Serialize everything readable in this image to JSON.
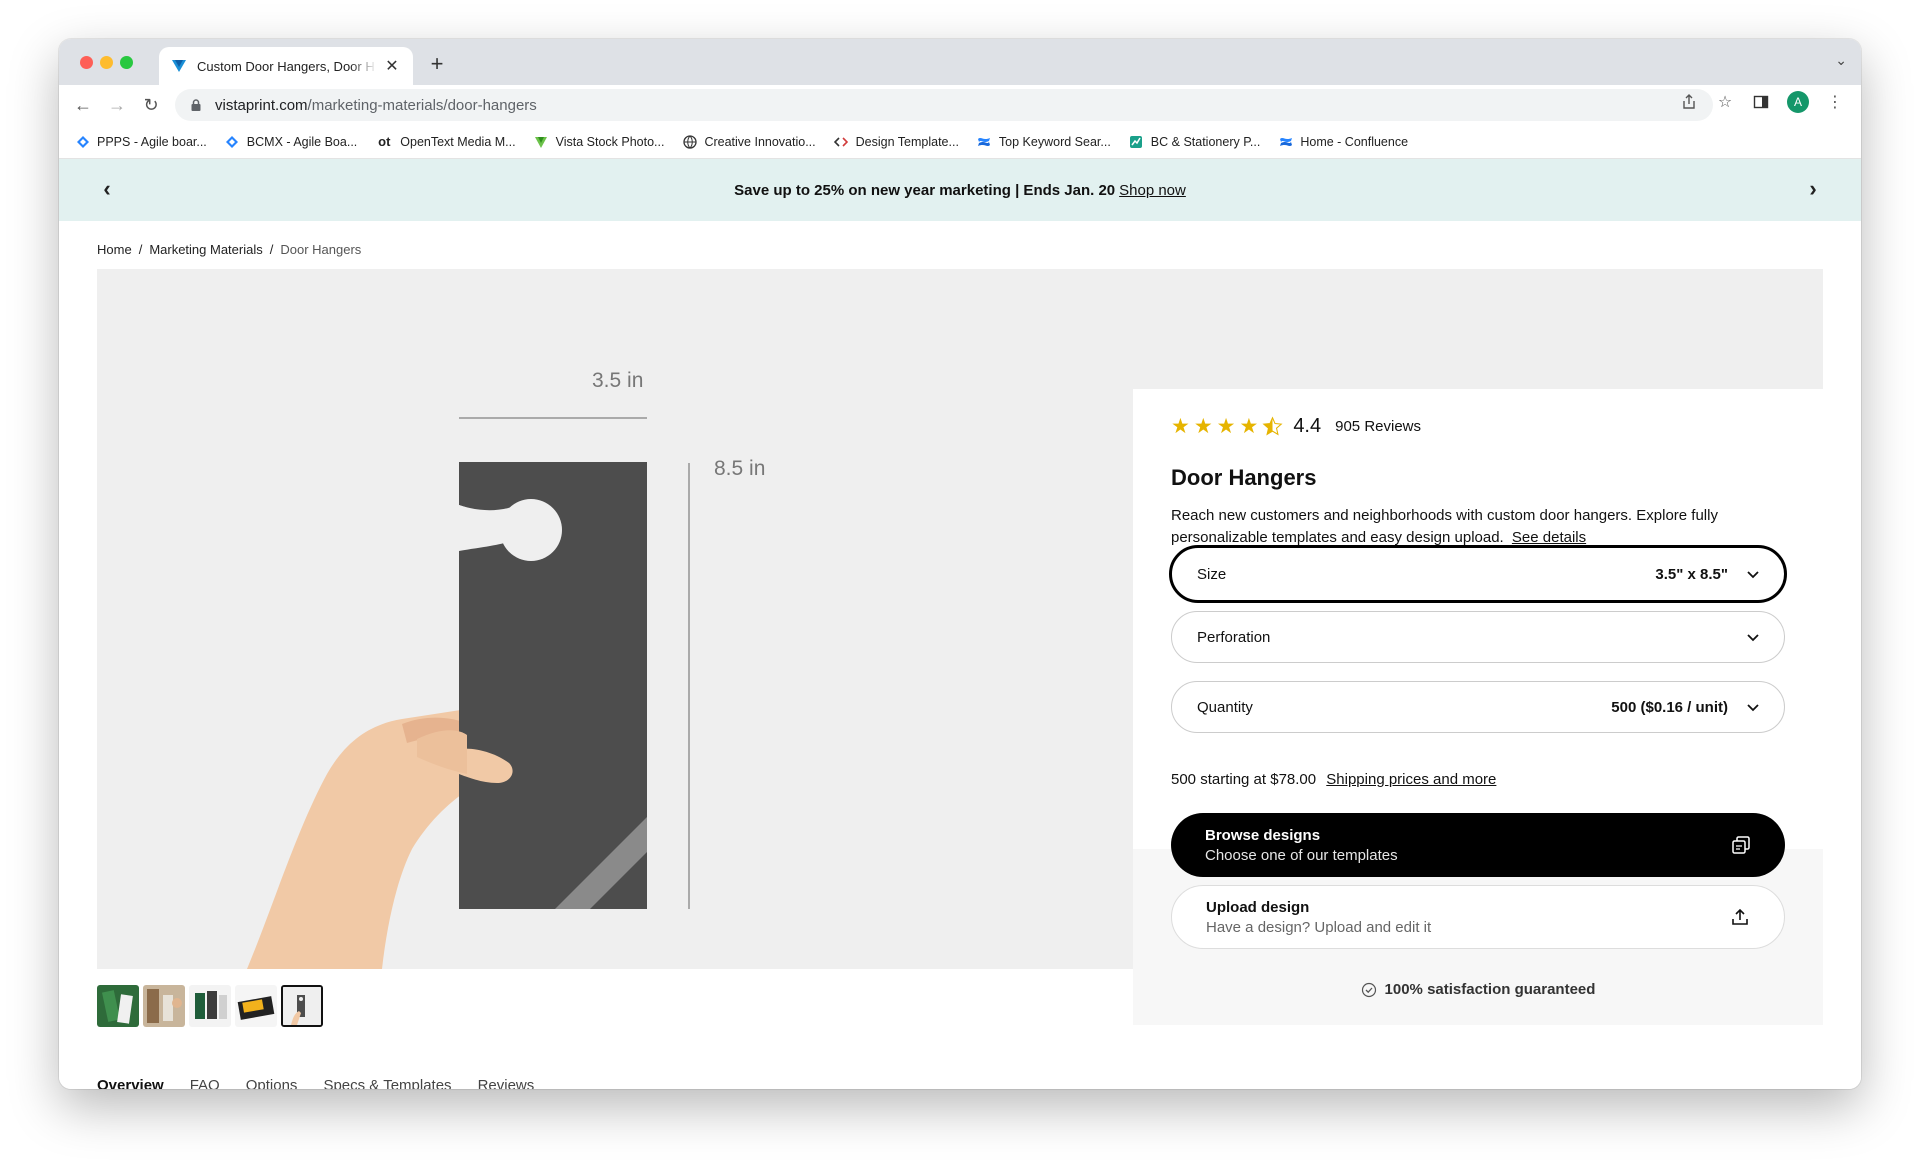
{
  "browser": {
    "tab_title": "Custom Door Hangers, Door H",
    "url_host": "vistaprint.com",
    "url_path": "/marketing-materials/door-hangers",
    "profile_initial": "A"
  },
  "bookmarks": [
    {
      "label": "PPPS - Agile boar...",
      "icon": "jira-icon"
    },
    {
      "label": "BCMX - Agile Boa...",
      "icon": "jira-icon"
    },
    {
      "label": "OpenText Media M...",
      "icon": "opentext-icon",
      "glyph": "ot"
    },
    {
      "label": "Vista Stock Photo...",
      "icon": "vista-icon"
    },
    {
      "label": "Creative Innovatio...",
      "icon": "globe-icon"
    },
    {
      "label": "Design Template...",
      "icon": "code-icon"
    },
    {
      "label": "Top Keyword Sear...",
      "icon": "confluence-icon"
    },
    {
      "label": "BC & Stationery P...",
      "icon": "chart-icon"
    },
    {
      "label": "Home - Confluence",
      "icon": "confluence-icon"
    }
  ],
  "promo": {
    "text": "Save up to 25% on new year marketing | Ends Jan. 20",
    "link": "Shop now"
  },
  "breadcrumbs": {
    "home": "Home",
    "sep": "/",
    "category": "Marketing Materials",
    "current": "Door Hangers"
  },
  "figure": {
    "width_label": "3.5 in",
    "height_label": "8.5 in"
  },
  "product": {
    "rating": "4.4",
    "rating_value": 4.4,
    "reviews": "905 Reviews",
    "title": "Door Hangers",
    "description": "Reach new customers and neighborhoods with custom door hangers. Explore fully personalizable templates and easy design upload.",
    "details_link": "See details",
    "size_label": "Size",
    "size_value": "3.5\" x 8.5\"",
    "perforation_label": "Perforation",
    "quantity_label": "Quantity",
    "quantity_value": "500 ($0.16 / unit)",
    "price_line": "500 starting at $78.00",
    "shipping_link": "Shipping prices and more",
    "browse_title": "Browse designs",
    "browse_sub": "Choose one of our templates",
    "upload_title": "Upload design",
    "upload_sub": "Have a design? Upload and edit it",
    "guarantee": "100% satisfaction guaranteed"
  },
  "subnav": [
    "Overview",
    "FAQ",
    "Options",
    "Specs & Templates",
    "Reviews"
  ],
  "colors": {
    "promo_bg": "#e2f1f0",
    "star": "#e6b400",
    "cta_dark": "#000000"
  }
}
